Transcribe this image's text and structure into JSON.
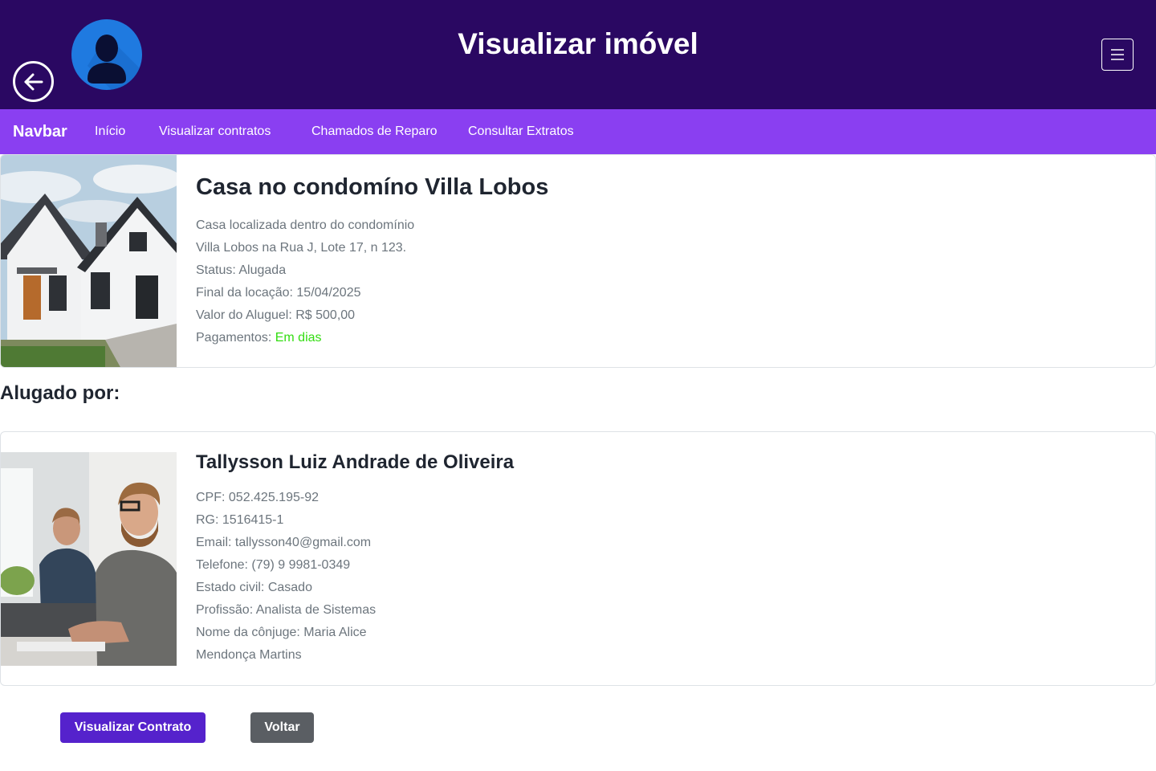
{
  "header": {
    "title": "Visualizar imóvel",
    "back_icon": "arrow-left-circle-icon",
    "avatar_icon": "user-silhouette-icon",
    "menu_icon": "hamburger-menu-icon"
  },
  "navbar": {
    "brand": "Navbar",
    "links": [
      "Início",
      "Visualizar contratos",
      "Chamados de Reparo",
      "Consultar Extratos"
    ]
  },
  "property": {
    "title": "Casa no condomíno Villa Lobos",
    "description_lines": [
      "Casa localizada dentro do condomínio",
      "Villa Lobos na Rua J, Lote 17, n 123."
    ],
    "status": "Status: Alugada",
    "lease_end": "Final da locação: 15/04/2025",
    "rent": "Valor do Aluguel: R$ 500,00",
    "payments_label": "Pagamentos: ",
    "payments_value": "Em dias"
  },
  "tenant_section": {
    "heading": "Alugado por:"
  },
  "tenant": {
    "name": "Tallysson Luiz Andrade de Oliveira",
    "cpf": "CPF: 052.425.195-92",
    "rg": "RG: 1516415-1",
    "email": "Email: tallysson40@gmail.com",
    "phone": "Telefone: (79) 9 9981-0349",
    "marital_status": "Estado civil: Casado",
    "profession": "Profissão: Analista de Sistemas",
    "spouse_lines": [
      "Nome da cônjuge: Maria Alice",
      "Mendonça Martins"
    ]
  },
  "actions": {
    "view_contract": "Visualizar Contrato",
    "back": "Voltar"
  },
  "colors": {
    "header_bg": "#2a0862",
    "navbar_bg": "#8a3ff1",
    "primary_button": "#5522cc",
    "secondary_button": "#5a5e63",
    "payment_ok": "#33dd11"
  }
}
